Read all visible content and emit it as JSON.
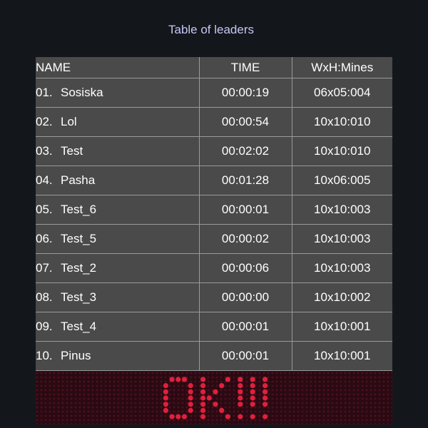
{
  "title": "Table of leaders",
  "columns": {
    "name": "NAME",
    "time": "TIME",
    "dim": "WxH:Mines"
  },
  "rows": [
    {
      "rank": "01.",
      "name": "Sosiska",
      "time": "00:00:19",
      "dim": "06x05:004"
    },
    {
      "rank": "02.",
      "name": "Lol",
      "time": "00:00:54",
      "dim": "10x10:010"
    },
    {
      "rank": "03.",
      "name": "Test",
      "time": "00:02:02",
      "dim": "10x10:010"
    },
    {
      "rank": "04.",
      "name": "Pasha",
      "time": "00:01:28",
      "dim": "10x06:005"
    },
    {
      "rank": "05.",
      "name": "Test_6",
      "time": "00:00:01",
      "dim": "10x10:003"
    },
    {
      "rank": "06.",
      "name": "Test_5",
      "time": "00:00:02",
      "dim": "10x10:003"
    },
    {
      "rank": "07.",
      "name": "Test_2",
      "time": "00:00:06",
      "dim": "10x10:003"
    },
    {
      "rank": "08.",
      "name": "Test_3",
      "time": "00:00:00",
      "dim": "10x10:002"
    },
    {
      "rank": "09.",
      "name": "Test_4",
      "time": "00:00:01",
      "dim": "10x10:001"
    },
    {
      "rank": "10.",
      "name": "Pinus",
      "time": "00:00:01",
      "dim": "10x10:001"
    }
  ],
  "ok_button": {
    "label": "OK!!!"
  },
  "colors": {
    "background": "#13171b",
    "table": "#4a4a4a",
    "title": "#c6c6f5",
    "lcd_dot_on": "#e0203c",
    "lcd_dot_off": "#4a1020"
  }
}
